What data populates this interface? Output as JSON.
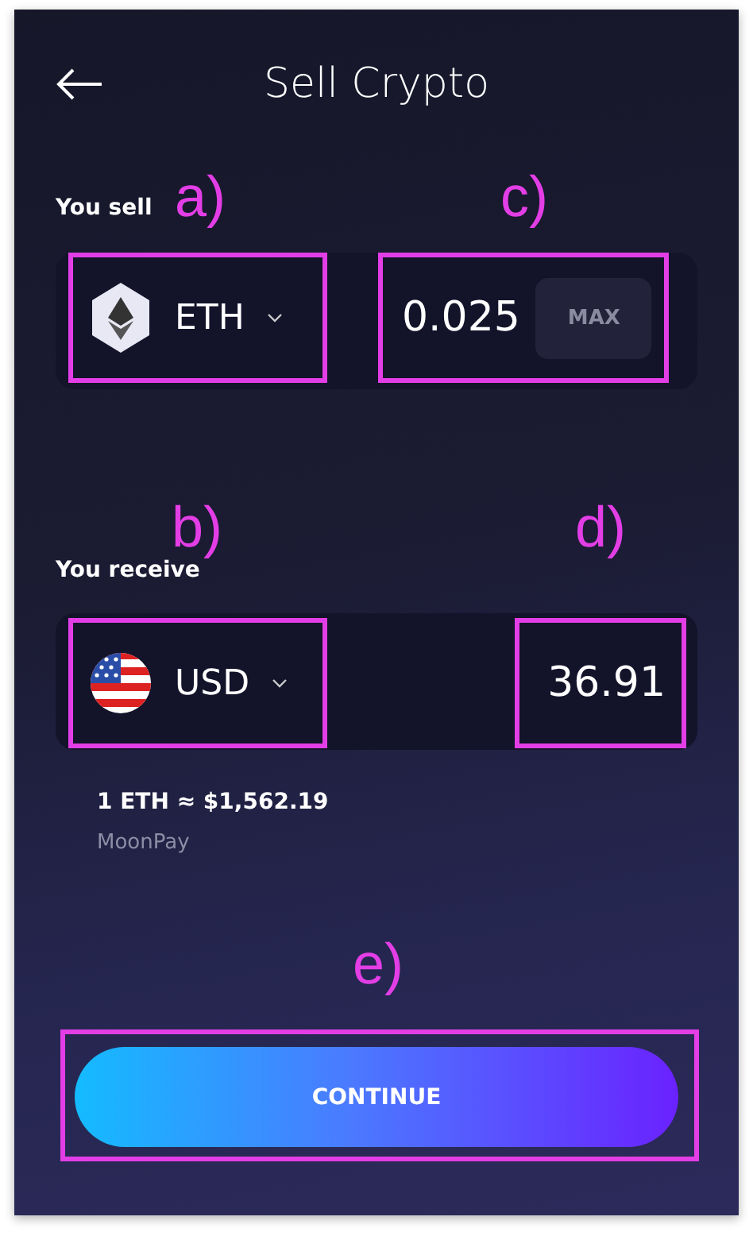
{
  "header": {
    "title": "Sell Crypto"
  },
  "sell": {
    "label": "You sell",
    "currency": "ETH",
    "amount": "0.025",
    "max_button": "MAX"
  },
  "receive": {
    "label": "You receive",
    "currency": "USD",
    "amount": "36.91"
  },
  "rate": "1 ETH ≈ $1,562.19",
  "provider": "MoonPay",
  "continue_button": "CONTINUE",
  "annotations": {
    "sell_currency": "a)",
    "receive_currency": "b)",
    "sell_amount": "c)",
    "receive_amount": "d)",
    "continue": "e)"
  }
}
